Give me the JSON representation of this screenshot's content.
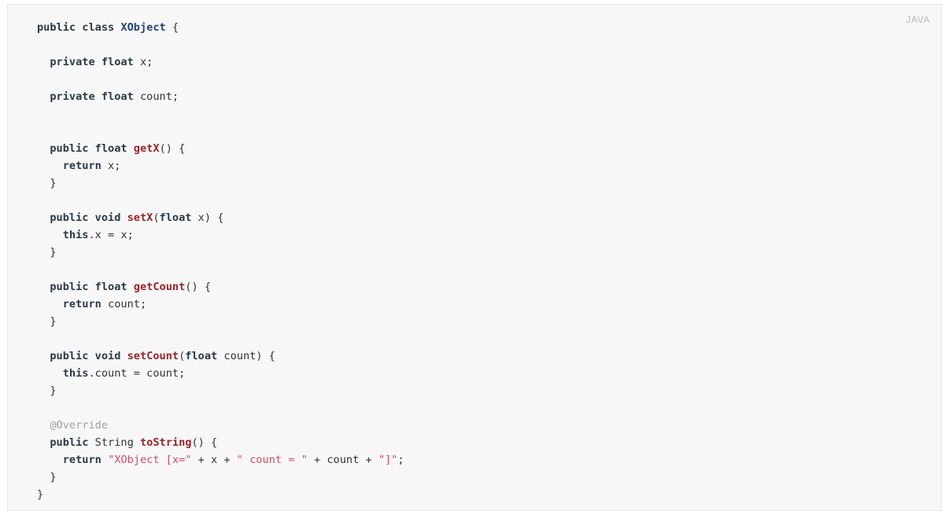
{
  "panel": {
    "language_label": "JAVA",
    "background_color": "#f7f7f7",
    "border_color": "#e4e4e4",
    "page_background": "#ffffff"
  },
  "colors": {
    "keyword": "#2b3a47",
    "class_name": "#24427a",
    "method_name": "#97252b",
    "string_literal": "#d14b63",
    "annotation": "#a0a0a0",
    "plain_text": "#333333"
  },
  "code": {
    "lines": [
      {
        "tokens": [
          {
            "t": "public",
            "c": "kw"
          },
          {
            "t": " ",
            "c": "pln"
          },
          {
            "t": "class",
            "c": "kw"
          },
          {
            "t": " ",
            "c": "pln"
          },
          {
            "t": "XObject",
            "c": "cls"
          },
          {
            "t": " {",
            "c": "pln"
          }
        ]
      },
      {
        "tokens": []
      },
      {
        "tokens": [
          {
            "t": "  ",
            "c": "pln"
          },
          {
            "t": "private",
            "c": "kw"
          },
          {
            "t": " ",
            "c": "pln"
          },
          {
            "t": "float",
            "c": "kw"
          },
          {
            "t": " x;",
            "c": "pln"
          }
        ]
      },
      {
        "tokens": []
      },
      {
        "tokens": [
          {
            "t": "  ",
            "c": "pln"
          },
          {
            "t": "private",
            "c": "kw"
          },
          {
            "t": " ",
            "c": "pln"
          },
          {
            "t": "float",
            "c": "kw"
          },
          {
            "t": " count;",
            "c": "pln"
          }
        ]
      },
      {
        "tokens": []
      },
      {
        "tokens": []
      },
      {
        "tokens": [
          {
            "t": "  ",
            "c": "pln"
          },
          {
            "t": "public",
            "c": "kw"
          },
          {
            "t": " ",
            "c": "pln"
          },
          {
            "t": "float",
            "c": "kw"
          },
          {
            "t": " ",
            "c": "pln"
          },
          {
            "t": "getX",
            "c": "fn"
          },
          {
            "t": "() {",
            "c": "pln"
          }
        ]
      },
      {
        "tokens": [
          {
            "t": "    ",
            "c": "pln"
          },
          {
            "t": "return",
            "c": "kw"
          },
          {
            "t": " x;",
            "c": "pln"
          }
        ]
      },
      {
        "tokens": [
          {
            "t": "  }",
            "c": "pln"
          }
        ]
      },
      {
        "tokens": []
      },
      {
        "tokens": [
          {
            "t": "  ",
            "c": "pln"
          },
          {
            "t": "public",
            "c": "kw"
          },
          {
            "t": " ",
            "c": "pln"
          },
          {
            "t": "void",
            "c": "kw"
          },
          {
            "t": " ",
            "c": "pln"
          },
          {
            "t": "setX",
            "c": "fn"
          },
          {
            "t": "(",
            "c": "pln"
          },
          {
            "t": "float",
            "c": "kw"
          },
          {
            "t": " x) {",
            "c": "pln"
          }
        ]
      },
      {
        "tokens": [
          {
            "t": "    ",
            "c": "pln"
          },
          {
            "t": "this",
            "c": "kw"
          },
          {
            "t": ".x = x;",
            "c": "pln"
          }
        ]
      },
      {
        "tokens": [
          {
            "t": "  }",
            "c": "pln"
          }
        ]
      },
      {
        "tokens": []
      },
      {
        "tokens": [
          {
            "t": "  ",
            "c": "pln"
          },
          {
            "t": "public",
            "c": "kw"
          },
          {
            "t": " ",
            "c": "pln"
          },
          {
            "t": "float",
            "c": "kw"
          },
          {
            "t": " ",
            "c": "pln"
          },
          {
            "t": "getCount",
            "c": "fn"
          },
          {
            "t": "() {",
            "c": "pln"
          }
        ]
      },
      {
        "tokens": [
          {
            "t": "    ",
            "c": "pln"
          },
          {
            "t": "return",
            "c": "kw"
          },
          {
            "t": " count;",
            "c": "pln"
          }
        ]
      },
      {
        "tokens": [
          {
            "t": "  }",
            "c": "pln"
          }
        ]
      },
      {
        "tokens": []
      },
      {
        "tokens": [
          {
            "t": "  ",
            "c": "pln"
          },
          {
            "t": "public",
            "c": "kw"
          },
          {
            "t": " ",
            "c": "pln"
          },
          {
            "t": "void",
            "c": "kw"
          },
          {
            "t": " ",
            "c": "pln"
          },
          {
            "t": "setCount",
            "c": "fn"
          },
          {
            "t": "(",
            "c": "pln"
          },
          {
            "t": "float",
            "c": "kw"
          },
          {
            "t": " count) {",
            "c": "pln"
          }
        ]
      },
      {
        "tokens": [
          {
            "t": "    ",
            "c": "pln"
          },
          {
            "t": "this",
            "c": "kw"
          },
          {
            "t": ".count = count;",
            "c": "pln"
          }
        ]
      },
      {
        "tokens": [
          {
            "t": "  }",
            "c": "pln"
          }
        ]
      },
      {
        "tokens": []
      },
      {
        "tokens": [
          {
            "t": "  ",
            "c": "pln"
          },
          {
            "t": "@Override",
            "c": "ann"
          }
        ]
      },
      {
        "tokens": [
          {
            "t": "  ",
            "c": "pln"
          },
          {
            "t": "public",
            "c": "kw"
          },
          {
            "t": " ",
            "c": "pln"
          },
          {
            "t": "String",
            "c": "typ"
          },
          {
            "t": " ",
            "c": "pln"
          },
          {
            "t": "toString",
            "c": "fn"
          },
          {
            "t": "() {",
            "c": "pln"
          }
        ]
      },
      {
        "tokens": [
          {
            "t": "    ",
            "c": "pln"
          },
          {
            "t": "return",
            "c": "kw"
          },
          {
            "t": " ",
            "c": "pln"
          },
          {
            "t": "\"XObject [x=\"",
            "c": "str"
          },
          {
            "t": " + x + ",
            "c": "pln"
          },
          {
            "t": "\" count = \"",
            "c": "str"
          },
          {
            "t": " + count + ",
            "c": "pln"
          },
          {
            "t": "\"]\"",
            "c": "str"
          },
          {
            "t": ";",
            "c": "pln"
          }
        ]
      },
      {
        "tokens": [
          {
            "t": "  }",
            "c": "pln"
          }
        ]
      },
      {
        "tokens": [
          {
            "t": "}",
            "c": "pln"
          }
        ]
      }
    ]
  }
}
